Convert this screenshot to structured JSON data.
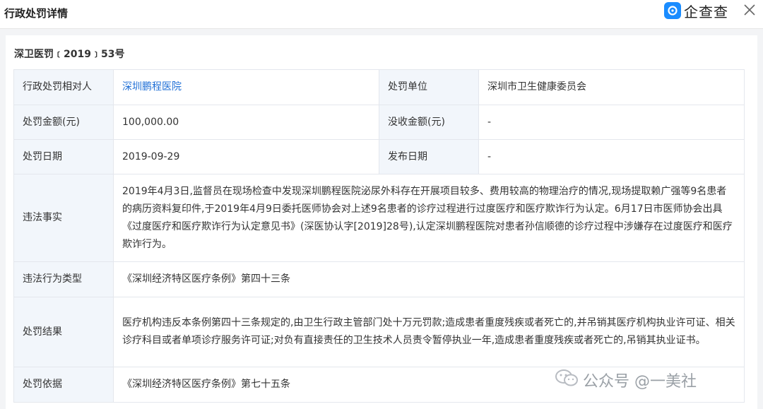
{
  "header": {
    "title": "行政处罚详情",
    "brand_name": "企查查",
    "brand_color": "#1a8cff",
    "close_icon": "close-icon"
  },
  "document": {
    "number": "深卫医罚﹝2019﹞53号"
  },
  "rows": {
    "party": {
      "label": "行政处罚相对人",
      "value": "深圳鹏程医院"
    },
    "unit": {
      "label": "处罚单位",
      "value": "深圳市卫生健康委员会"
    },
    "fine": {
      "label": "处罚金额(元)",
      "value": "100,000.00"
    },
    "confiscation": {
      "label": "没收金额(元)",
      "value": "-"
    },
    "date": {
      "label": "处罚日期",
      "value": "2019-09-29"
    },
    "publish_date": {
      "label": "发布日期",
      "value": "-"
    },
    "facts": {
      "label": "违法事实",
      "value": "2019年4月3日,监督员在现场检查中发现深圳鹏程医院泌尿外科存在开展项目较多、费用较高的物理治疗的情况,现场提取赖广强等9名患者的病历资料复印件,于2019年4月9日委托医师协会对上述9名患者的诊疗过程进行过度医疗和医疗欺诈行为认定。6月17日市医师协会出具《过度医疗和医疗欺诈行为认定意见书》(深医协认字[2019]28号),认定深圳鹏程医院对患者孙信顺德的诊疗过程中涉嫌存在过度医疗和医疗欺诈行为。"
    },
    "violation_type": {
      "label": "违法行为类型",
      "value": "《深圳经济特区医疗条例》第四十三条"
    },
    "result": {
      "label": "处罚结果",
      "value": "医疗机构违反本条例第四十三条规定的,由卫生行政主管部门处十万元罚款;造成患者重度残疾或者死亡的,并吊销其医疗机构执业许可证、相关诊疗科目或者单项诊疗服务许可证;对负有直接责任的卫生技术人员责令暂停执业一年,造成患者重度残疾或者死亡的,吊销其执业证书。"
    },
    "basis": {
      "label": "处罚依据",
      "value": "《深圳经济特区医疗条例》第七十五条"
    }
  },
  "watermark": {
    "text": "公众号 @一美社",
    "icon": "wechat-icon"
  }
}
